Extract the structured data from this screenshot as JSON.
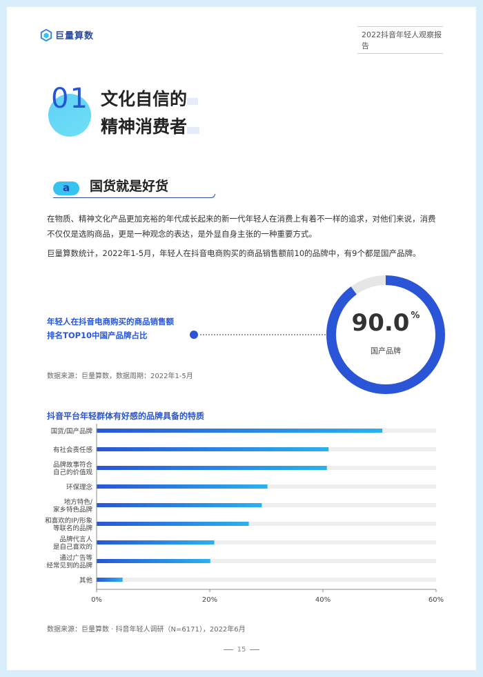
{
  "header": {
    "brand": "巨量算数",
    "report_title": "2022抖音年轻人观察报告"
  },
  "section": {
    "number": "01",
    "title_line1": "文化自信的",
    "title_line2": "精神消费者"
  },
  "subsection": {
    "tag": "a",
    "title": "国货就是好货"
  },
  "paragraphs": [
    "在物质、精神文化产品更加充裕的年代成长起来的新一代年轻人在消费上有着不一样的追求，对他们来说，消费不仅仅是选购商品，更是一种观念的表达，是外显自身主张的一种重要方式。",
    "巨量算数统计，2022年1-5月，年轻人在抖音电商购买的商品销售额前10的品牌中，有9个都是国产品牌。"
  ],
  "stat": {
    "label_line1": "年轻人在抖音电商购买的商品销售额",
    "label_line2": "排名TOP10中国产品牌占比",
    "value": "90.0",
    "unit": "%",
    "caption": "国产品牌",
    "fraction": 0.9,
    "source": "数据来源：巨量算数，数据周期：2022年1-5月"
  },
  "colors": {
    "accent": "#2a55d6",
    "bar_dark": "#2a55d6",
    "bar_light": "#2ab1ee",
    "track": "#eeeeee"
  },
  "chart_data": {
    "type": "bar",
    "orientation": "horizontal",
    "title": "抖音平台年轻群体有好感的品牌具备的特质",
    "categories": [
      "国货/国产品牌",
      "有社会责任感",
      "品牌故事符合自己的价值观",
      "环保理念",
      "地方特色/家乡特色品牌",
      "和喜欢的IP/形象等联名的品牌",
      "品牌代言人是自己喜欢的",
      "通过广告等经常见到的品牌",
      "其他"
    ],
    "category_lines": [
      [
        "国货/国产品牌"
      ],
      [
        "有社会责任感"
      ],
      [
        "品牌故事符合",
        "自己的价值观"
      ],
      [
        "环保理念"
      ],
      [
        "地方特色/",
        "家乡特色品牌"
      ],
      [
        "和喜欢的IP/形象",
        "等联名的品牌"
      ],
      [
        "品牌代言人",
        "是自己喜欢的"
      ],
      [
        "通过广告等",
        "经常见到的品牌"
      ],
      [
        "其他"
      ]
    ],
    "values": [
      50.5,
      41.0,
      40.7,
      30.2,
      29.2,
      26.9,
      20.8,
      20.1,
      4.6
    ],
    "xlim": [
      0,
      60
    ],
    "xticks": [
      "0%",
      "20%",
      "40%",
      "60%"
    ],
    "grid": false,
    "source": "数据来源：巨量算数 · 抖音年轻人调研（N=6171），2022年6月"
  },
  "footer": {
    "page_number": "15"
  }
}
